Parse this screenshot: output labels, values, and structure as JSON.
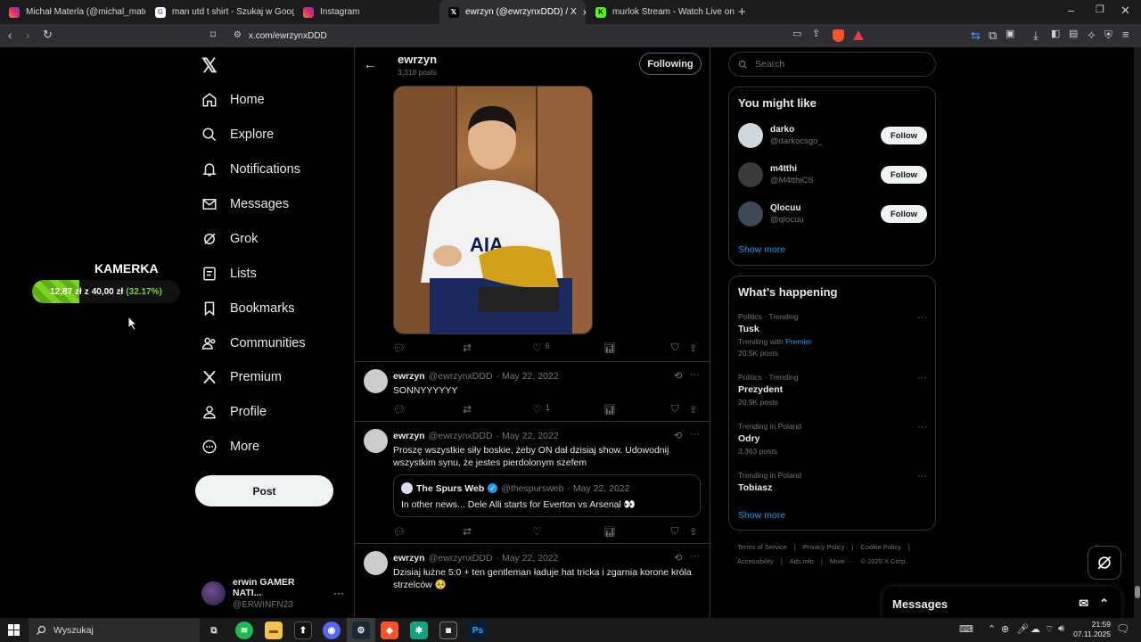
{
  "browser": {
    "tabs": [
      {
        "title": "Michał Materla (@michal_materla) • I",
        "favicon": "instagram-icon"
      },
      {
        "title": "man utd t shirt - Szukaj w Google",
        "favicon": "google-icon"
      },
      {
        "title": "Instagram",
        "favicon": "instagram-icon"
      },
      {
        "title": "ewrzyn (@ewrzynxDDD) / X",
        "favicon": "x-icon",
        "active": true
      },
      {
        "title": "murlok Stream - Watch Live on Kick",
        "favicon": "kick-icon"
      }
    ],
    "url": "x.com/ewrzynxDDD",
    "accent_brave": "#fb542b"
  },
  "overlay": {
    "title": "KAMERKA",
    "current": "12,87 zł",
    "separator": "z",
    "goal": "40,00 zł",
    "percent_label": "(32.17%)",
    "progress": 0.3217
  },
  "nav": {
    "items": [
      {
        "label": "Home",
        "icon": "home-icon"
      },
      {
        "label": "Explore",
        "icon": "search-icon"
      },
      {
        "label": "Notifications",
        "icon": "bell-icon"
      },
      {
        "label": "Messages",
        "icon": "envelope-icon"
      },
      {
        "label": "Grok",
        "icon": "grok-icon"
      },
      {
        "label": "Lists",
        "icon": "list-icon"
      },
      {
        "label": "Bookmarks",
        "icon": "bookmark-icon"
      },
      {
        "label": "Communities",
        "icon": "people-icon"
      },
      {
        "label": "Premium",
        "icon": "x-icon"
      },
      {
        "label": "Profile",
        "icon": "person-icon"
      },
      {
        "label": "More",
        "icon": "more-circle-icon"
      }
    ],
    "post_label": "Post",
    "account": {
      "name": "erwin GAMER NATI...",
      "handle": "@ERWINFN23"
    }
  },
  "profile_header": {
    "name": "ewrzyn",
    "posts": "3,318 posts",
    "following_label": "Following"
  },
  "media_tweet": {
    "likes": "6"
  },
  "tweets": [
    {
      "name": "ewrzyn",
      "handle": "@ewrzynxDDD",
      "date": "· May 22, 2022",
      "text": "SONNYYYYYY",
      "likes": "1"
    },
    {
      "name": "ewrzyn",
      "handle": "@ewrzynxDDD",
      "date": "· May 22, 2022",
      "text": "Proszę wszystkie siły boskie, żeby ON dał dzisiaj show. Udowodnij wszystkim synu, że jestes pierdolonym szefem",
      "likes": "",
      "quote": {
        "name": "The Spurs Web",
        "handle": "@thespursweb",
        "date": "· May 22, 2022",
        "text": "In other news... Dele Alli starts for Everton vs Arsenal 👀"
      }
    },
    {
      "name": "ewrzyn",
      "handle": "@ewrzynxDDD",
      "date": "· May 22, 2022",
      "text": "Dzisiaj łużne 5:0 + ten gentleman ładuje hat tricka i zgarnia korone króla strzelców 🥺"
    }
  ],
  "right": {
    "search_placeholder": "Search",
    "you_might_like": {
      "title": "You might like",
      "users": [
        {
          "name": "darko",
          "handle": "@darkocsgo_",
          "button": "Follow"
        },
        {
          "name": "m4tthi",
          "handle": "@M4tthiCS",
          "button": "Follow"
        },
        {
          "name": "Qlocuu",
          "handle": "@qlocuu",
          "button": "Follow"
        }
      ],
      "show_more": "Show more"
    },
    "happening": {
      "title": "What’s happening",
      "trends": [
        {
          "category": "Politics · Trending",
          "name": "Tusk",
          "extra": "Trending with",
          "extra_link": "Premier",
          "posts": "20.5K posts"
        },
        {
          "category": "Politics · Trending",
          "name": "Prezydent",
          "extra": "",
          "extra_link": "",
          "posts": "20.9K posts"
        },
        {
          "category": "Trending in Poland",
          "name": "Odry",
          "extra": "",
          "extra_link": "",
          "posts": "3,363 posts"
        },
        {
          "category": "Trending in Poland",
          "name": "Tobiasz",
          "extra": "",
          "extra_link": "",
          "posts": ""
        }
      ],
      "show_more": "Show more"
    },
    "footer": {
      "row1": [
        "Terms of Service",
        "|",
        "Privacy Policy",
        "|",
        "Cookie Policy",
        "|"
      ],
      "row2": [
        "Accessibility",
        "|",
        "Ads info",
        "|",
        "More ···",
        "© 2025 X Corp."
      ]
    },
    "messages_label": "Messages"
  },
  "taskbar": {
    "search_label": "Wyszukaj",
    "time": "21:59",
    "date": "07.11.2025"
  },
  "colors": {
    "accent": "#1d9bf0",
    "progress_green": "#7dd321"
  }
}
